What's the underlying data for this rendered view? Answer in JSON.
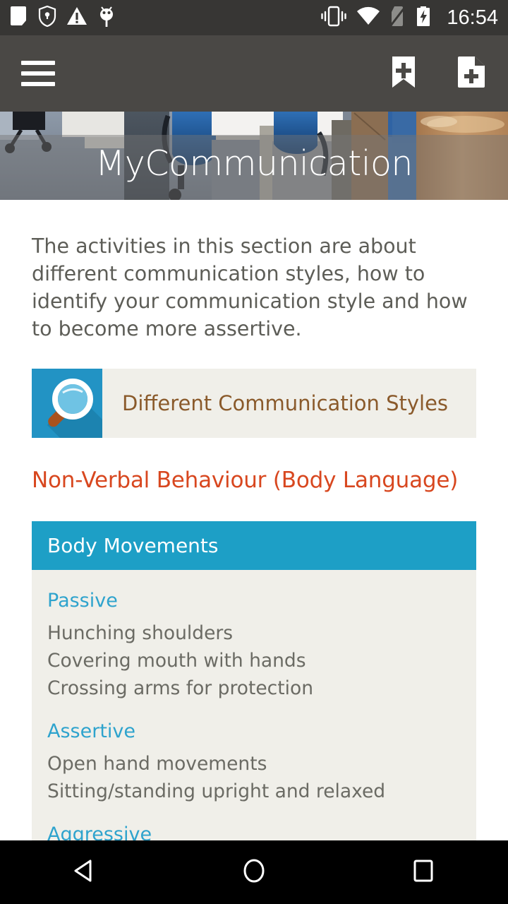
{
  "statusbar": {
    "time": "16:54",
    "icons_left": [
      "note-app-icon",
      "shield-vpn-icon",
      "warning-triangle-icon",
      "android-debug-icon"
    ],
    "icons_right": [
      "vibrate-icon",
      "wifi-icon",
      "no-sim-icon",
      "battery-charging-icon"
    ]
  },
  "appbar": {
    "menu_icon": "hamburger-menu-icon",
    "actions": [
      {
        "name": "add-bookmark",
        "icon": "bookmark-add-icon"
      },
      {
        "name": "add-note",
        "icon": "note-add-icon"
      }
    ]
  },
  "hero": {
    "title": "MyCommunication"
  },
  "main": {
    "intro": "The activities in this section are about different communication styles, how to identify your communication style and how to become more assertive.",
    "activity_card": {
      "icon": "magnifier-icon",
      "label": "Different Communication Styles"
    },
    "section_heading": "Non-Verbal Behaviour (Body Language)",
    "panel": {
      "header": "Body Movements",
      "groups": [
        {
          "title": "Passive",
          "items": [
            "Hunching shoulders",
            "Covering mouth with hands",
            "Crossing arms for protection"
          ]
        },
        {
          "title": "Assertive",
          "items": [
            "Open hand movements",
            "Sitting/standing upright and relaxed"
          ]
        },
        {
          "title": "Aggressive",
          "items": []
        }
      ]
    }
  },
  "navbar": {
    "buttons": [
      {
        "name": "back",
        "icon": "back-triangle-icon"
      },
      {
        "name": "home",
        "icon": "home-circle-icon"
      },
      {
        "name": "recents",
        "icon": "recents-square-icon"
      }
    ]
  },
  "colors": {
    "statusbar_bg": "#373634",
    "appbar_bg": "#4a4845",
    "accent_blue": "#1d9fc6",
    "style_title_blue": "#2ea3cd",
    "heading_red": "#d8471f",
    "card_bg": "#f0efe9",
    "card_label_brown": "#8a5a2b",
    "body_text": "#5d5d57",
    "navbar_bg": "#000000"
  }
}
